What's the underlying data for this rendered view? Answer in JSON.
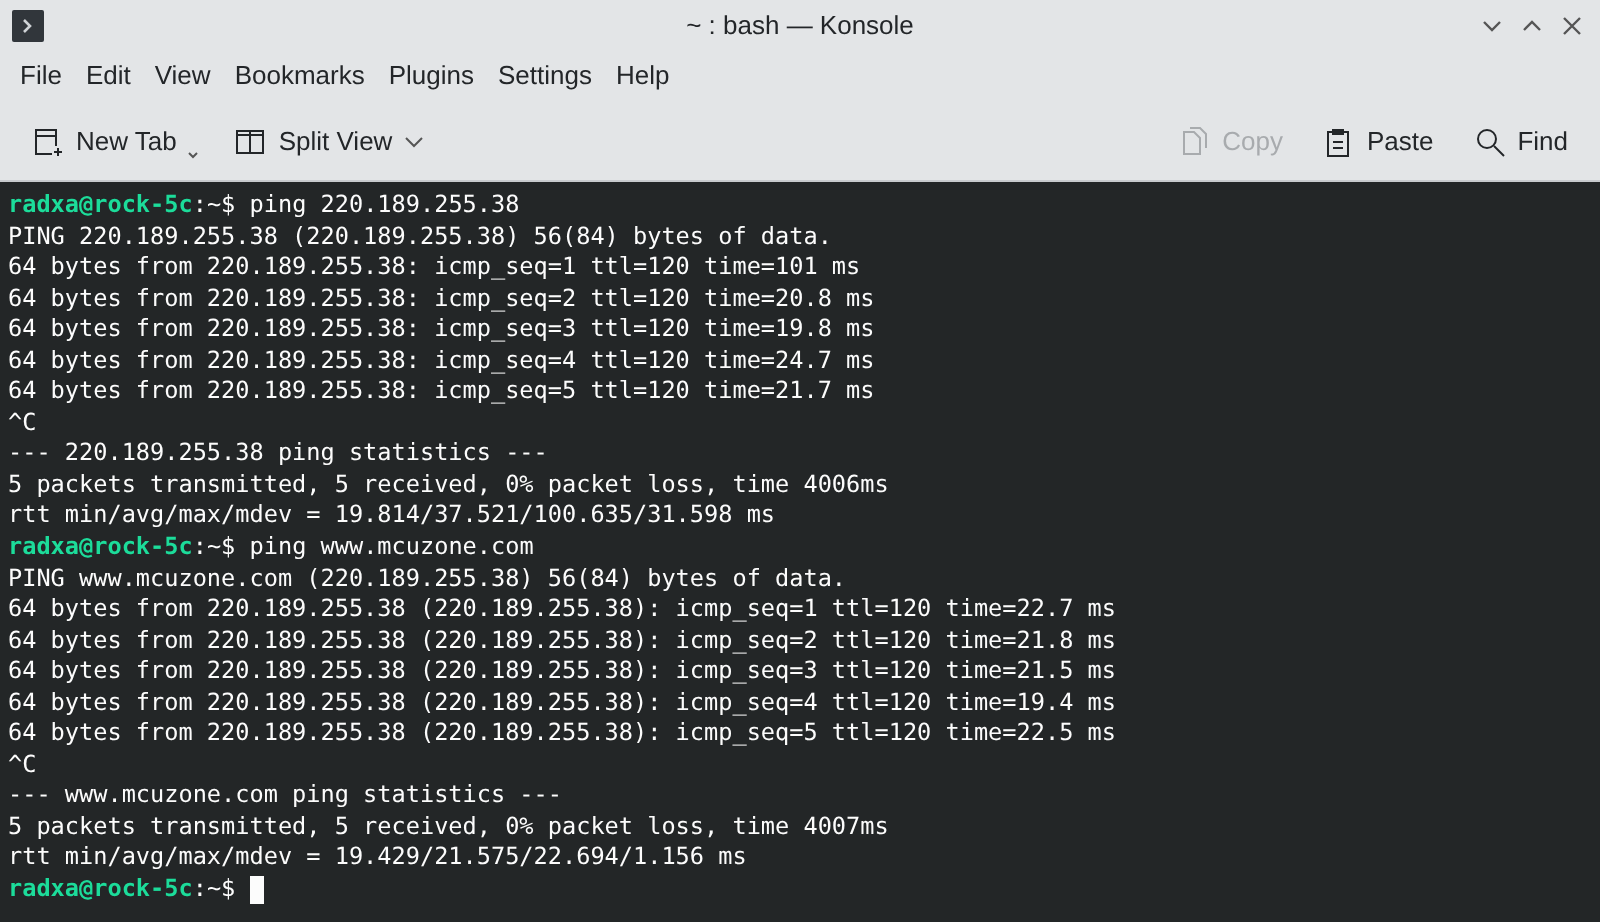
{
  "window": {
    "title": "~ : bash — Konsole"
  },
  "menu": [
    "File",
    "Edit",
    "View",
    "Bookmarks",
    "Plugins",
    "Settings",
    "Help"
  ],
  "toolbar_left": [
    {
      "label": "New Tab",
      "kind": "newtab"
    },
    {
      "label": "Split View",
      "kind": "split"
    }
  ],
  "toolbar_right": [
    {
      "label": "Copy",
      "kind": "copy",
      "disabled": true
    },
    {
      "label": "Paste",
      "kind": "paste",
      "disabled": false
    },
    {
      "label": "Find",
      "kind": "find",
      "disabled": false
    }
  ],
  "terminal": {
    "lines": [
      {
        "kind": "prompt",
        "user_host": "radxa@rock-5c",
        "path": ":~$ ",
        "command": "ping 220.189.255.38"
      },
      {
        "kind": "output",
        "text": "PING 220.189.255.38 (220.189.255.38) 56(84) bytes of data."
      },
      {
        "kind": "output",
        "text": "64 bytes from 220.189.255.38: icmp_seq=1 ttl=120 time=101 ms"
      },
      {
        "kind": "output",
        "text": "64 bytes from 220.189.255.38: icmp_seq=2 ttl=120 time=20.8 ms"
      },
      {
        "kind": "output",
        "text": "64 bytes from 220.189.255.38: icmp_seq=3 ttl=120 time=19.8 ms"
      },
      {
        "kind": "output",
        "text": "64 bytes from 220.189.255.38: icmp_seq=4 ttl=120 time=24.7 ms"
      },
      {
        "kind": "output",
        "text": "64 bytes from 220.189.255.38: icmp_seq=5 ttl=120 time=21.7 ms"
      },
      {
        "kind": "output",
        "text": "^C"
      },
      {
        "kind": "output",
        "text": "--- 220.189.255.38 ping statistics ---"
      },
      {
        "kind": "output",
        "text": "5 packets transmitted, 5 received, 0% packet loss, time 4006ms"
      },
      {
        "kind": "output",
        "text": "rtt min/avg/max/mdev = 19.814/37.521/100.635/31.598 ms"
      },
      {
        "kind": "prompt",
        "user_host": "radxa@rock-5c",
        "path": ":~$ ",
        "command": "ping www.mcuzone.com"
      },
      {
        "kind": "output",
        "text": "PING www.mcuzone.com (220.189.255.38) 56(84) bytes of data."
      },
      {
        "kind": "output",
        "text": "64 bytes from 220.189.255.38 (220.189.255.38): icmp_seq=1 ttl=120 time=22.7 ms"
      },
      {
        "kind": "output",
        "text": "64 bytes from 220.189.255.38 (220.189.255.38): icmp_seq=2 ttl=120 time=21.8 ms"
      },
      {
        "kind": "output",
        "text": "64 bytes from 220.189.255.38 (220.189.255.38): icmp_seq=3 ttl=120 time=21.5 ms"
      },
      {
        "kind": "output",
        "text": "64 bytes from 220.189.255.38 (220.189.255.38): icmp_seq=4 ttl=120 time=19.4 ms"
      },
      {
        "kind": "output",
        "text": "64 bytes from 220.189.255.38 (220.189.255.38): icmp_seq=5 ttl=120 time=22.5 ms"
      },
      {
        "kind": "output",
        "text": "^C"
      },
      {
        "kind": "output",
        "text": "--- www.mcuzone.com ping statistics ---"
      },
      {
        "kind": "output",
        "text": "5 packets transmitted, 5 received, 0% packet loss, time 4007ms"
      },
      {
        "kind": "output",
        "text": "rtt min/avg/max/mdev = 19.429/21.575/22.694/1.156 ms"
      },
      {
        "kind": "prompt",
        "user_host": "radxa@rock-5c",
        "path": ":~$ ",
        "cursor": true
      }
    ]
  }
}
